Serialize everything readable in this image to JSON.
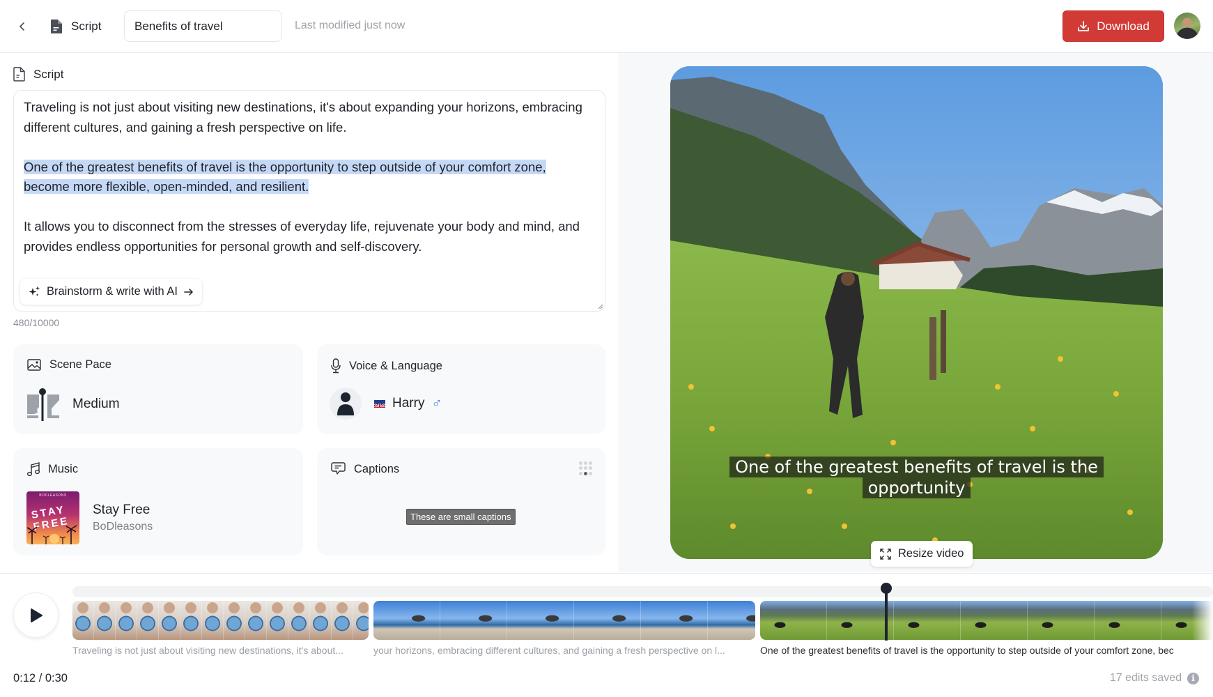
{
  "topbar": {
    "crumb_label": "Script",
    "title_value": "Benefits of travel",
    "last_modified": "Last modified just now",
    "download_label": "Download",
    "download_color": "#d23a35"
  },
  "script": {
    "label": "Script",
    "paragraphs": [
      "Traveling is not just about visiting new destinations, it's about expanding your horizons, embracing different cultures, and gaining a fresh perspective on life.",
      "One of the greatest benefits of travel is the opportunity to step outside of your comfort zone, become more flexible, open-minded, and resilient.",
      "It allows you to disconnect from the stresses of everyday life, rejuvenate your body and mind, and provides endless opportunities for personal growth and self-discovery."
    ],
    "selected_paragraph": 1,
    "ai_button_label": "Brainstorm & write with AI",
    "char_count": "480/10000"
  },
  "cards": {
    "scene_pace": {
      "label": "Scene Pace",
      "value": "Medium"
    },
    "voice": {
      "label": "Voice & Language",
      "name": "Harry",
      "flag": "uk-flag",
      "gender_symbol": "♂"
    },
    "music": {
      "label": "Music",
      "title": "Stay Free",
      "artist": "BoDleasons",
      "album_top": "BODLEASONS",
      "album_art_text": "STAY FREE"
    },
    "captions": {
      "label": "Captions",
      "sample": "These are small captions",
      "position_grid_active": "bottom-center"
    }
  },
  "preview": {
    "caption_lines": [
      "One of the greatest benefits of travel is the",
      "opportunity"
    ],
    "resize_label": "Resize video"
  },
  "timeline": {
    "clips": [
      {
        "label": "Traveling is not just about visiting new destinations, it's about...",
        "scene": "globe",
        "active": false
      },
      {
        "label": "your horizons, embracing different cultures, and gaining a fresh perspective on l...",
        "scene": "beach",
        "active": false
      },
      {
        "label": "One of the greatest benefits of travel is the opportunity to step outside of your comfort zone, bec",
        "scene": "meadow",
        "active": true
      }
    ],
    "current_time": "0:12",
    "total_time": "0:30",
    "time_display": "0:12 / 0:30",
    "edits_saved": "17 edits saved"
  }
}
